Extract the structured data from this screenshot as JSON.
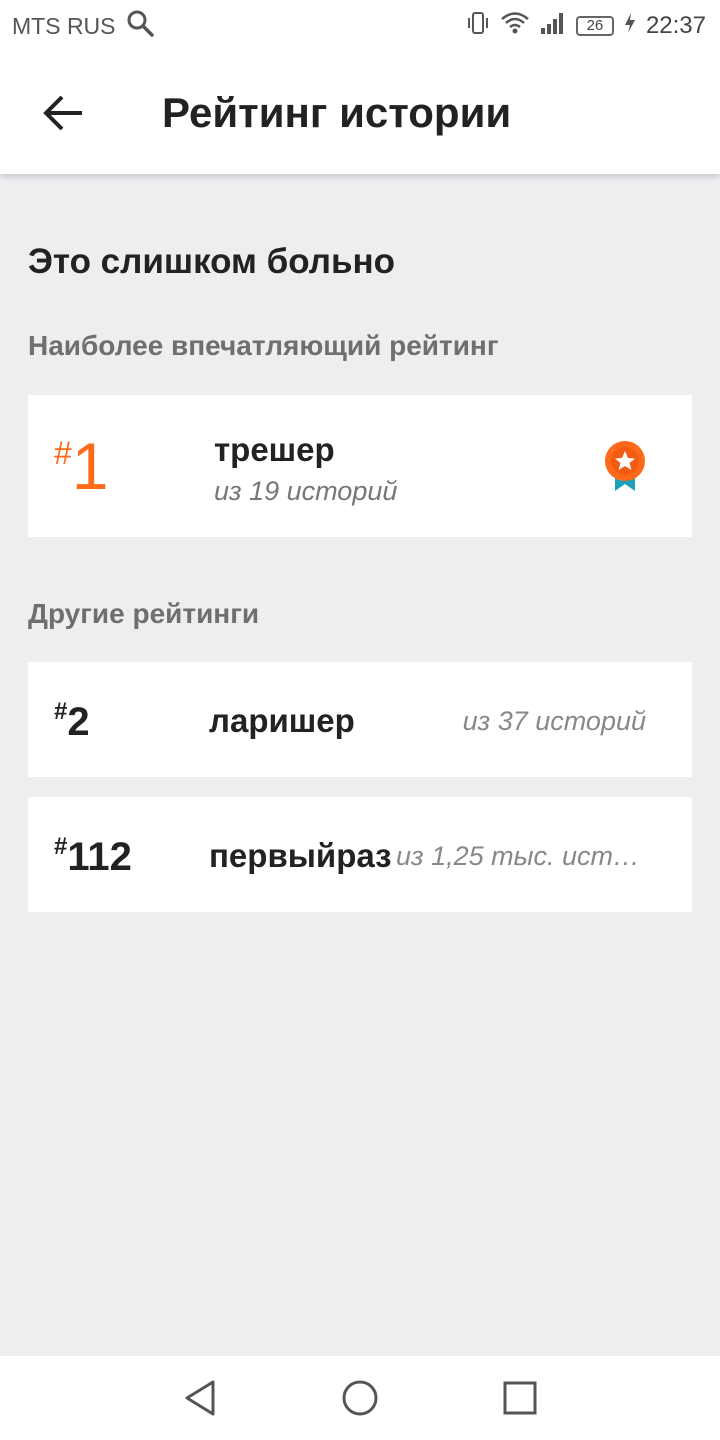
{
  "status_bar": {
    "carrier": "MTS RUS",
    "battery": "26",
    "time": "22:37"
  },
  "header": {
    "title": "Рейтинг истории"
  },
  "story": {
    "title": "Это слишком больно"
  },
  "top_rating": {
    "section_label": "Наиболее впечатляющий рейтинг",
    "hash": "#",
    "rank": "1",
    "tag": "трешер",
    "count": "из 19 историй",
    "accent_color": "#ff6a1a",
    "medal_icon": "medal-star-icon"
  },
  "other_ratings": {
    "section_label": "Другие рейтинги",
    "items": [
      {
        "hash": "#",
        "rank": "2",
        "tag": "ларишер",
        "count": "из 37 историй"
      },
      {
        "hash": "#",
        "rank": "112",
        "tag": "первыйраз",
        "count": "из 1,25 тыс. исто..."
      }
    ]
  },
  "nav_bar": {
    "icons": [
      "back-triangle-icon",
      "home-circle-icon",
      "recents-square-icon"
    ]
  }
}
